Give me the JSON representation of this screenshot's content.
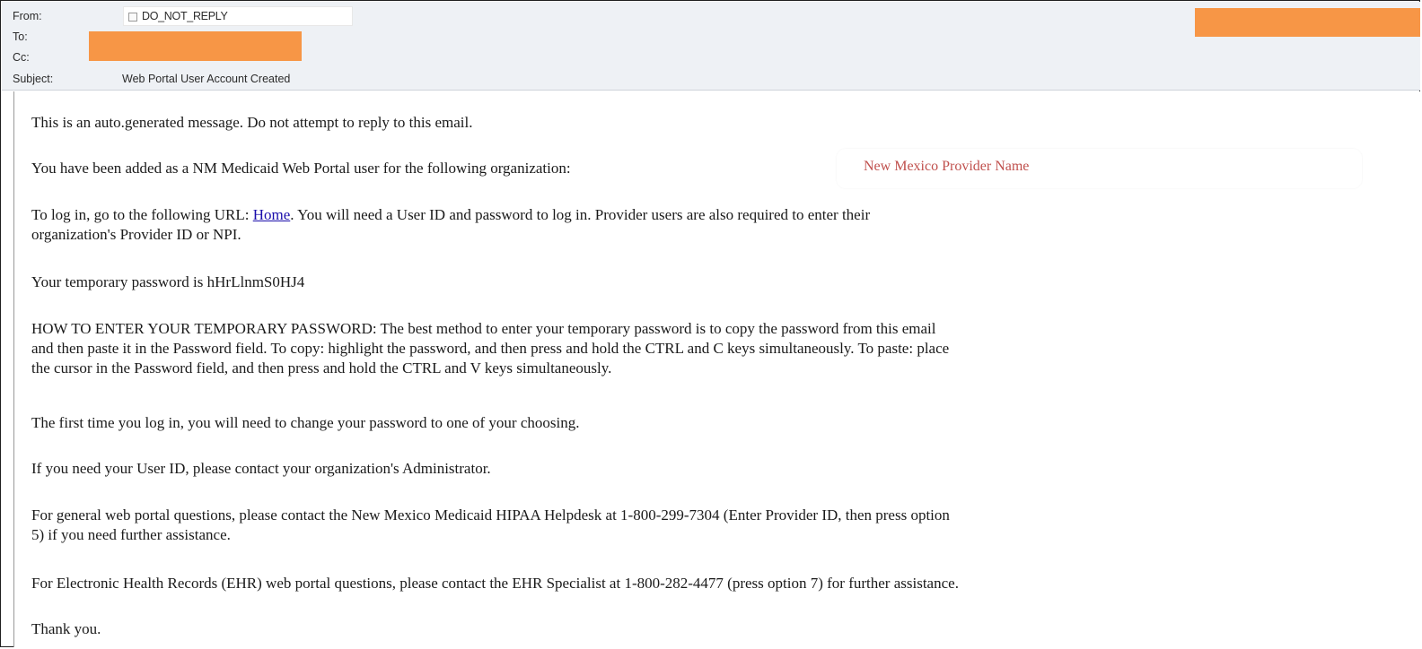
{
  "header": {
    "from_label": "From:",
    "from_value": "DO_NOT_REPLY",
    "to_label": "To:",
    "cc_label": "Cc:",
    "subject_label": "Subject:",
    "subject_value": "Web Portal User Account Created",
    "redaction_color": "#f79646"
  },
  "body": {
    "p1": "This is an auto.generated message. Do not attempt to reply to this email.",
    "p2": "You have been added as a NM Medicaid Web Portal user for the following organization:",
    "org_name": "New Mexico Provider Name",
    "org_name_color": "#c0504d",
    "p3_before": "To log in, go to the following URL: ",
    "p3_link": "Home",
    "p3_after_line1": ". You will need a User ID and password to log in. Provider users are also required to enter their",
    "p3_line2": "organization's Provider ID or NPI.",
    "p4": "Your temporary password is hHrLlnmS0HJ4",
    "p5_line1": "HOW TO ENTER YOUR TEMPORARY PASSWORD: The best method to enter your temporary password is to copy the password from this email",
    "p5_line2": "and then paste it in the Password field. To copy: highlight the password, and then press and hold the CTRL and C keys simultaneously. To paste: place",
    "p5_line3": "the cursor in the Password field, and then press and hold the CTRL and V keys simultaneously.",
    "p6": "The first time you log in, you will need to change your password to one of your choosing.",
    "p7": "If you need your User ID, please contact your organization's Administrator.",
    "p8_line1": "For general web portal questions, please contact the New Mexico Medicaid HIPAA Helpdesk at 1-800-299-7304 (Enter Provider ID, then press option",
    "p8_line2": "5) if you need further assistance.",
    "p9": "For Electronic Health Records (EHR) web portal questions, please contact the EHR Specialist at 1-800-282-4477 (press option 7) for further assistance.",
    "p10": "Thank you."
  }
}
